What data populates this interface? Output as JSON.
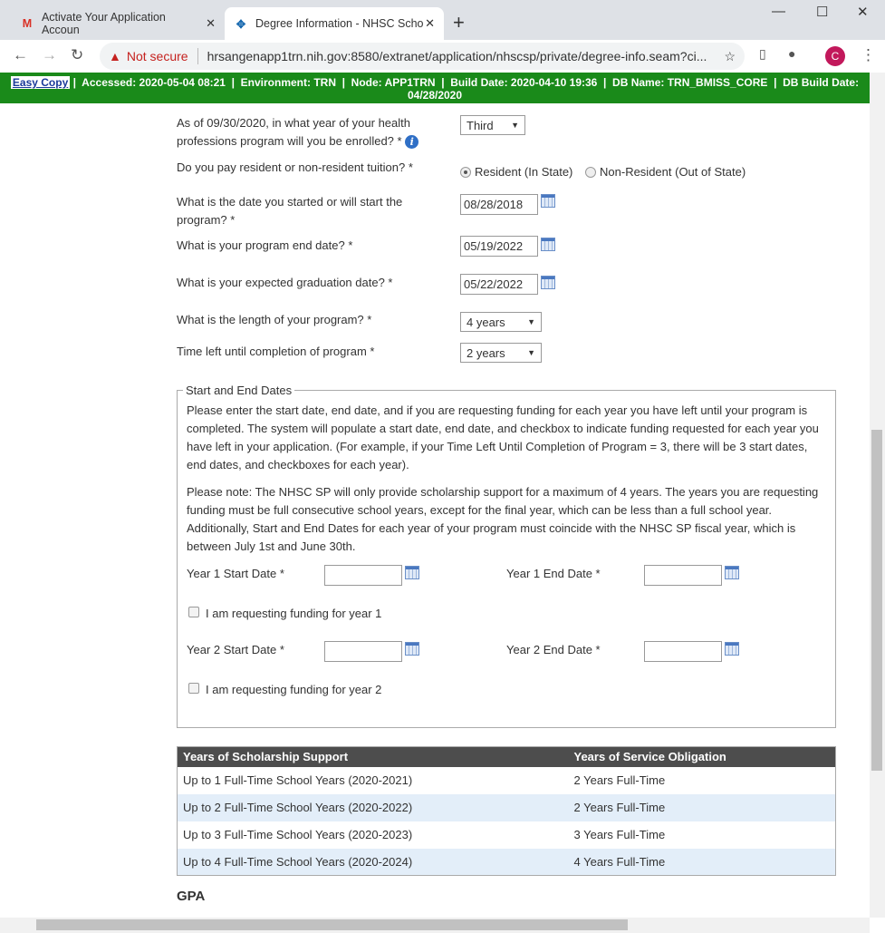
{
  "browser": {
    "tabs": [
      {
        "icon": "M",
        "title": "Activate Your Application Accoun"
      },
      {
        "title": "Degree Information - NHSC Scho"
      }
    ],
    "security": "Not secure",
    "url": "hrsangenapp1trn.nih.gov:8580/extranet/application/nhscsp/private/degree-info.seam?ci...",
    "profile": "C"
  },
  "env": {
    "easy_copy": "Easy Copy",
    "text": " |  Accessed: 2020-05-04 08:21  |  Environment: TRN  |  Node: APP1TRN  |  Build Date: 2020-04-10 19:36  |  DB Name: TRN_BMISS_CORE  |  DB Build Date: 04/28/2020"
  },
  "form": {
    "year_q": "As of 09/30/2020, in what year of your health professions program will you be enrolled? *",
    "year_val": "Third",
    "tuition_q": "Do you pay resident or non-resident tuition? *",
    "tuition_opts": [
      "Resident (In State)",
      "Non-Resident (Out of State)"
    ],
    "start_q": "What is the date you started or will start the program? *",
    "start_val": "08/28/2018",
    "end_q": "What is your program end date? *",
    "end_val": "05/19/2022",
    "grad_q": "What is your expected graduation date? *",
    "grad_val": "05/22/2022",
    "length_q": "What is the length of your program? *",
    "length_val": "4 years",
    "left_q": "Time left until completion of program *",
    "left_val": "2 years"
  },
  "dates": {
    "legend": "Start and End Dates",
    "p1": "Please enter the start date, end date, and if you are requesting funding for each year you have left until your program is completed. The system will populate a start date, end date, and checkbox to indicate funding requested for each year you have left in your application. (For example, if your Time Left Until Completion of Program = 3, there will be 3 start dates, end dates, and checkboxes for each year).",
    "p2": "Please note: The NHSC SP will only provide scholarship support for a maximum of 4 years. The years you are requesting funding must be full consecutive school years, except for the final year, which can be less than a full school year. Additionally, Start and End Dates for each year of your program must coincide with the NHSC SP fiscal year, which is between July 1st and June 30th.",
    "y1s": "Year 1 Start Date *",
    "y1e": "Year 1 End Date *",
    "y1cb": "I am requesting funding for year 1",
    "y2s": "Year 2 Start Date *",
    "y2e": "Year 2 End Date *",
    "y2cb": "I am requesting funding for year 2"
  },
  "table": {
    "headers": [
      "Years of Scholarship Support",
      "Years of Service Obligation"
    ],
    "rows": [
      [
        "Up to 1 Full-Time School Years (2020-2021)",
        "2 Years Full-Time"
      ],
      [
        "Up to 2 Full-Time School Years (2020-2022)",
        "2 Years Full-Time"
      ],
      [
        "Up to 3 Full-Time School Years (2020-2023)",
        "3 Years Full-Time"
      ],
      [
        "Up to 4 Full-Time School Years (2020-2024)",
        "4 Years Full-Time"
      ]
    ]
  },
  "gpa": {
    "title": "GPA"
  }
}
